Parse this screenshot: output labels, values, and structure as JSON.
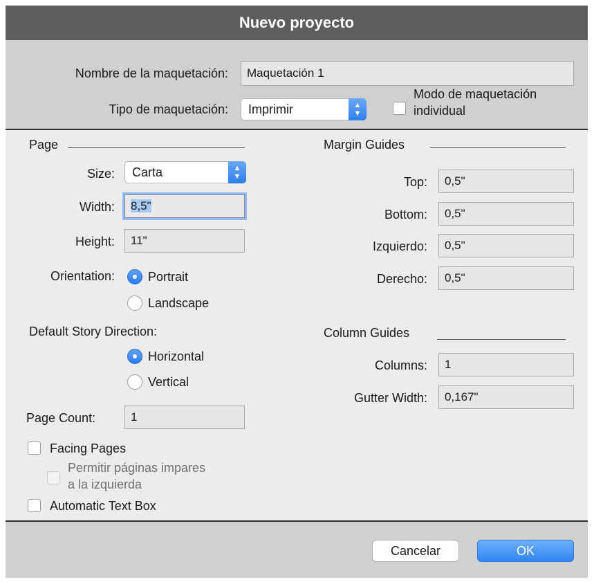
{
  "window": {
    "title": "Nuevo proyecto"
  },
  "top": {
    "layout_name_label": "Nombre de la maquetación:",
    "layout_name_value": "Maquetación 1",
    "layout_type_label": "Tipo de maquetación:",
    "layout_type_value": "Imprimir",
    "single_layout_mode_line1": "Modo de maquetación",
    "single_layout_mode_line2": "individual",
    "single_layout_mode_checked": false
  },
  "page": {
    "section_title": "Page",
    "size_label": "Size:",
    "size_value": "Carta",
    "width_label": "Width:",
    "width_value": "8,5\"",
    "height_label": "Height:",
    "height_value": "11\"",
    "orientation_label": "Orientation:",
    "orientation_options": [
      "Portrait",
      "Landscape"
    ],
    "orientation_selected": "Portrait",
    "story_direction_label": "Default Story Direction:",
    "story_direction_options": [
      "Horizontal",
      "Vertical"
    ],
    "story_direction_selected": "Horizontal",
    "page_count_label": "Page Count:",
    "page_count_value": "1",
    "facing_pages_label": "Facing Pages",
    "facing_pages_checked": false,
    "allow_odd_left_line1": "Permitir páginas impares",
    "allow_odd_left_line2": "a la izquierda",
    "allow_odd_left_enabled": false,
    "automatic_text_box_label": "Automatic Text Box",
    "automatic_text_box_checked": false
  },
  "margins": {
    "section_title": "Margin Guides",
    "top_label": "Top:",
    "top_value": "0,5\"",
    "bottom_label": "Bottom:",
    "bottom_value": "0,5\"",
    "left_label": "Izquierdo:",
    "left_value": "0,5\"",
    "right_label": "Derecho:",
    "right_value": "0,5\""
  },
  "columns": {
    "section_title": "Column Guides",
    "columns_label": "Columns:",
    "columns_value": "1",
    "gutter_label": "Gutter Width:",
    "gutter_value": "0,167\""
  },
  "footer": {
    "cancel_label": "Cancelar",
    "ok_label": "OK"
  },
  "icons": {
    "popup_arrows": "chevron-up-down-icon"
  }
}
